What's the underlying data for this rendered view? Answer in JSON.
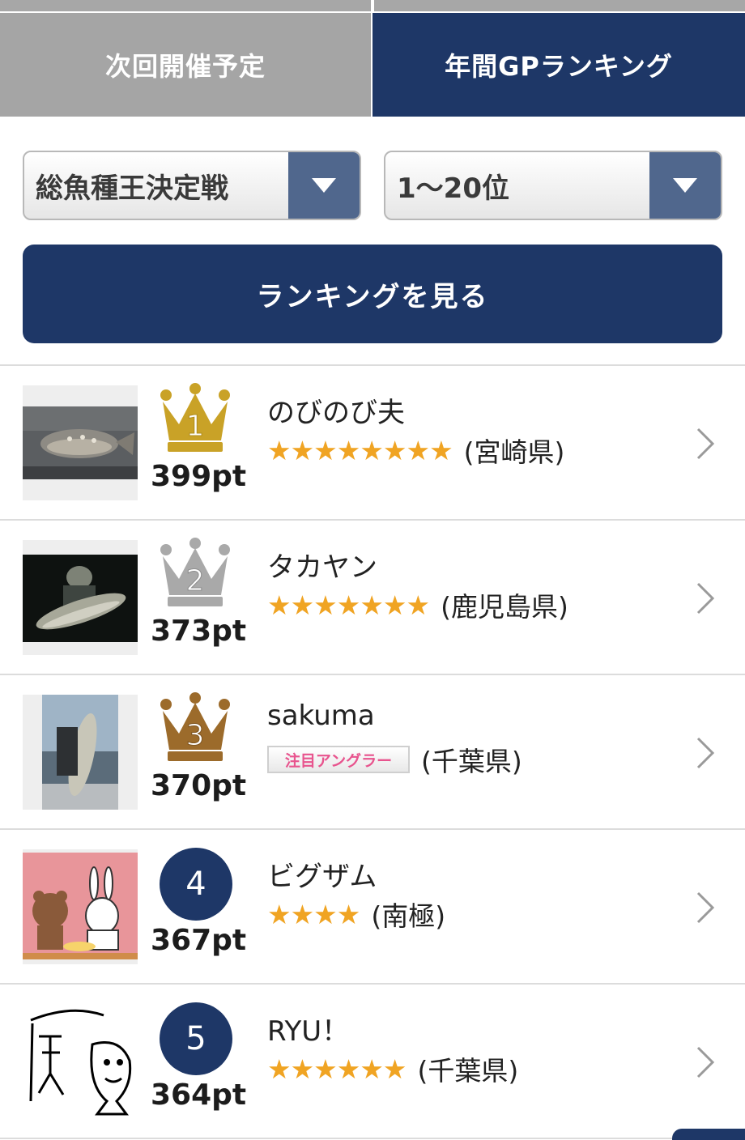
{
  "tabs": [
    {
      "label": "次回開催予定",
      "active": false
    },
    {
      "label": "年間GPランキング",
      "active": true
    }
  ],
  "filters": {
    "event": "総魚種王決定戦",
    "range": "1〜20位"
  },
  "view_button": "ランキングを見る",
  "ranking": [
    {
      "rank": 1,
      "points": "399pt",
      "name": "のびのび夫",
      "stars": "★★★★★★★★",
      "prefecture": "(宮崎県)",
      "medal": "gold"
    },
    {
      "rank": 2,
      "points": "373pt",
      "name": "タカヤン",
      "stars": "★★★★★★★",
      "prefecture": "(鹿児島県)",
      "medal": "silver"
    },
    {
      "rank": 3,
      "points": "370pt",
      "name": "sakuma",
      "tag": "注目アングラー",
      "prefecture": "(千葉県)",
      "medal": "bronze"
    },
    {
      "rank": 4,
      "points": "367pt",
      "name": "ビグザム",
      "stars": "★★★★",
      "prefecture": "(南極)"
    },
    {
      "rank": 5,
      "points": "364pt",
      "name": "RYU！",
      "stars": "★★★★★★",
      "prefecture": "(千葉県)"
    }
  ],
  "colors": {
    "navy": "#1e3767",
    "tab_inactive": "#a5a5a5",
    "star": "#f0a423",
    "gold": "#c9a227",
    "silver": "#a9a9a9",
    "bronze": "#9c6b2b"
  }
}
